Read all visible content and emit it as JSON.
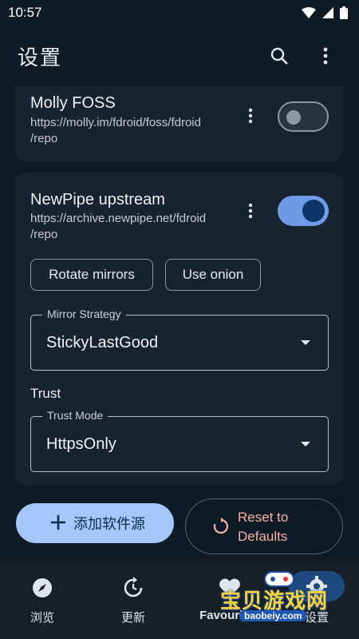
{
  "status_bar": {
    "time": "10:57"
  },
  "app_bar": {
    "title": "设置"
  },
  "repos": [
    {
      "name": "Molly FOSS",
      "url": "https://molly.im/fdroid/foss/fdroid/repo",
      "url_line1": "https://molly.im/fdroid/foss/fdroid",
      "url_line2": "/repo",
      "enabled": false
    },
    {
      "name": "NewPipe upstream",
      "url": "https://archive.newpipe.net/fdroid/repo",
      "url_line1": "https://archive.newpipe.net/fdroid",
      "url_line2": "/repo",
      "enabled": true
    }
  ],
  "repo_actions": {
    "rotate_mirrors": "Rotate mirrors",
    "use_onion": "Use onion"
  },
  "mirror_strategy": {
    "label": "Mirror Strategy",
    "value": "StickyLastGood"
  },
  "trust": {
    "section_title": "Trust",
    "label": "Trust Mode",
    "value": "HttpsOnly"
  },
  "buttons": {
    "add_repo": "添加软件源",
    "reset_line1": "Reset to",
    "reset_line2": "Defaults"
  },
  "nav": [
    {
      "label": "浏览",
      "icon": "compass-icon"
    },
    {
      "label": "更新",
      "icon": "refresh-icon"
    },
    {
      "label": "Favourites",
      "icon": "heart-icon"
    },
    {
      "label": "设置",
      "icon": "gear-icon",
      "selected": true
    }
  ],
  "watermark": {
    "text": "宝贝游戏网",
    "sub": "baobeiy.com"
  },
  "colors": {
    "background": "#0e1a24",
    "card": "#172430",
    "accent": "#a4c8fb",
    "switch_on": "#6f9ae6",
    "reset_text": "#f6b2a5"
  }
}
